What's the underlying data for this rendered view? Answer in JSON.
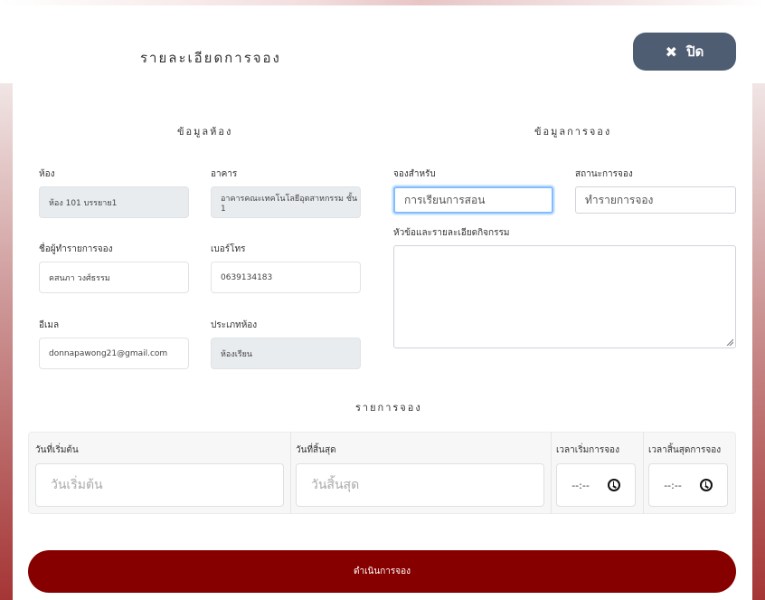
{
  "modal": {
    "title": "รายละเอียดการจอง",
    "close_label": "ปิด",
    "close_icon": "times-icon"
  },
  "room_info": {
    "section_title": "ข้อมูลห้อง",
    "room_label": "ห้อง",
    "room_value": "ห้อง 101 บรรยาย1",
    "building_label": "อาคาร",
    "building_value": "อาคารคณะเทคโนโลยีอุตสาหกรรม ชั้น 1",
    "booker_label": "ชื่อผู้ทำรายการจอง",
    "booker_value": "คสนภา วงศ์ธรรม",
    "phone_label": "เบอร์โทร",
    "phone_value": "0639134183",
    "email_label": "อีเมล",
    "email_value": "donnapawong21@gmail.com",
    "room_type_label": "ประเภทห้อง",
    "room_type_value": "ห้องเรียน"
  },
  "booking_info": {
    "section_title": "ข้อมูลการจอง",
    "purpose_label": "จองสำหรับ",
    "purpose_value": "การเรียนการสอน",
    "status_label": "สถานะการจอง",
    "status_value": "ทำรายการจอง",
    "details_label": "หัวข้อและรายละเอียดกิจกรรม",
    "details_value": ""
  },
  "schedule": {
    "section_title": "รายการจอง",
    "start_date_label": "วันที่เริ่มต้น",
    "start_date_placeholder": "วันเริ่มต้น",
    "end_date_label": "วันที่สิ้นสุด",
    "end_date_placeholder": "วันสิ้นสุด",
    "start_time_label": "เวลาเริ่มการจอง",
    "start_time_value": "--:--",
    "end_time_label": "เวลาสิ้นสุดการจอง",
    "end_time_value": "--:--"
  },
  "submit_label": "ดำเนินการจอง",
  "colors": {
    "close_button": "#4f5d73",
    "submit_button": "#860000",
    "readonly_field": "#e9ecef",
    "focus_border": "#80bdff"
  }
}
